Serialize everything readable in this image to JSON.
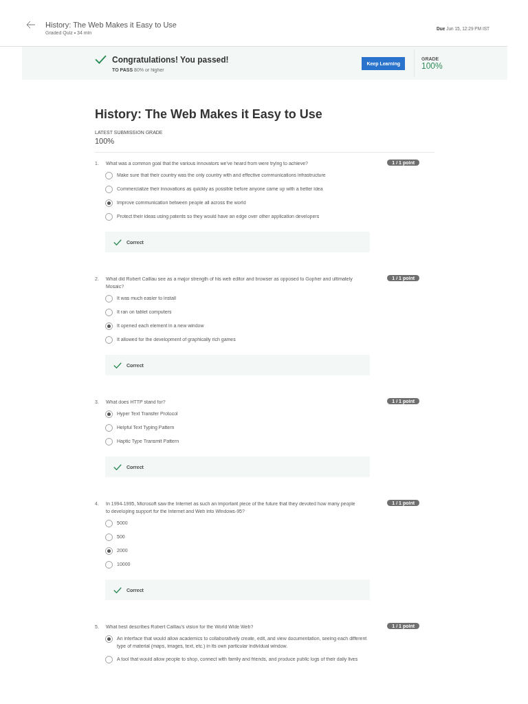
{
  "header": {
    "title": "History: The Web Makes it Easy to Use",
    "subtitle": "Graded Quiz • 34 min",
    "due_label": "Due",
    "due_value": "Jun 15, 12:29 PM IST"
  },
  "banner": {
    "message": "Congratulations! You passed!",
    "pass_label": "TO PASS",
    "pass_value": "80% or higher",
    "button": "Keep Learning",
    "grade_label": "GRADE",
    "grade_value": "100%"
  },
  "quiz": {
    "title": "History: The Web Makes it Easy to Use",
    "grade_label": "LATEST SUBMISSION GRADE",
    "grade_value": "100%"
  },
  "questions": [
    {
      "number": "1.",
      "text": "What was a common goal that the various innovators we've heard from were trying to achieve?",
      "score": "1 / 1 point",
      "options": [
        {
          "label": "Make sure that their country was the only country with and effective communications infrastructure",
          "selected": false
        },
        {
          "label": "Commercialize their innovations as quickly as possible before anyone came up with a better idea",
          "selected": false
        },
        {
          "label": "Improve communication between people all across the world",
          "selected": true
        },
        {
          "label": "Protect their ideas using patents so they would have an edge over other application developers",
          "selected": false
        }
      ],
      "feedback": "Correct"
    },
    {
      "number": "2.",
      "text": "What did Robert Caillau see as a major strength of his web editor and browser as opposed to Gopher and ultimately Mosaic?",
      "score": "1 / 1 point",
      "options": [
        {
          "label": "It was much easier to install",
          "selected": false
        },
        {
          "label": "It ran on tablet computers",
          "selected": false
        },
        {
          "label": "It opened each element in a new window",
          "selected": true
        },
        {
          "label": "It allowed for the development of graphically rich games",
          "selected": false
        }
      ],
      "feedback": "Correct"
    },
    {
      "number": "3.",
      "text": "What does HTTP stand for?",
      "score": "1 / 1 point",
      "options": [
        {
          "label": "Hyper Text Transfer Protocol",
          "selected": true
        },
        {
          "label": "Helpful Text Typing Pattern",
          "selected": false
        },
        {
          "label": "Haptic Type Transmit Pattern",
          "selected": false
        }
      ],
      "feedback": "Correct"
    },
    {
      "number": "4.",
      "text": "In 1994-1995, Microsoft saw the Internet as such an important piece of the future that they devoted how many people to developing support for the Internet and Web into Windows-95?",
      "score": "1 / 1 point",
      "options": [
        {
          "label": "5000",
          "selected": false
        },
        {
          "label": "500",
          "selected": false
        },
        {
          "label": "2000",
          "selected": true
        },
        {
          "label": "10000",
          "selected": false
        }
      ],
      "feedback": "Correct"
    },
    {
      "number": "5.",
      "text": "What best describes Robert Caillau's vision for the World Wide Web?",
      "score": "1 / 1 point",
      "options": [
        {
          "label": "An interface that would allow academics to collaboratively create, edit, and view documentation, seeing each different type of material (maps, images, text, etc.) in its own particular individual window.",
          "selected": true
        },
        {
          "label": "A tool that would allow people to shop, connect with family and friends, and produce public logs of their daily lives",
          "selected": false
        }
      ]
    }
  ]
}
